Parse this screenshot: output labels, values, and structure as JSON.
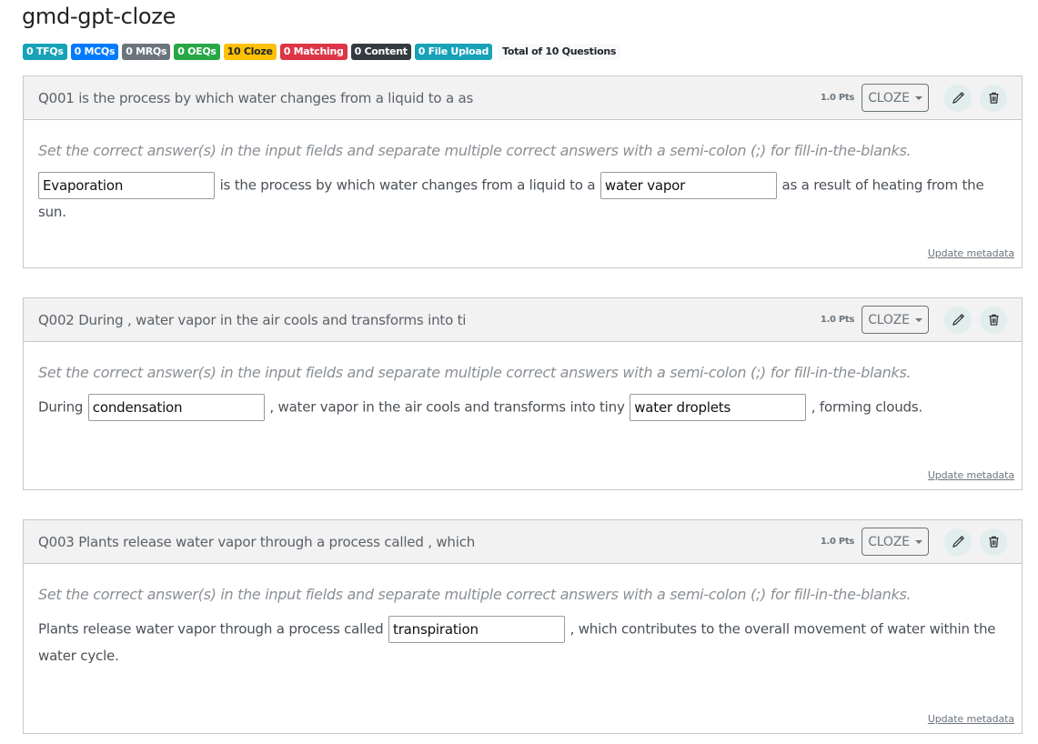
{
  "page": {
    "title": "gmd-gpt-cloze"
  },
  "badges": [
    {
      "label": "0 TFQs",
      "color": "#17a2b8"
    },
    {
      "label": "0 MCQs",
      "color": "#007bff"
    },
    {
      "label": "0 MRQs",
      "color": "#6c757d"
    },
    {
      "label": "0 OEQs",
      "color": "#28a745"
    },
    {
      "label": "10 Cloze",
      "color": "#ffc107"
    },
    {
      "label": "0 Matching",
      "color": "#dc3545"
    },
    {
      "label": "0 Content",
      "color": "#343a40"
    },
    {
      "label": "0 File Upload",
      "color": "#17a2b8"
    }
  ],
  "total_label": "Total of 10 Questions",
  "common": {
    "points": "1.0 Pts",
    "type": "CLOZE",
    "instructions": "Set the correct answer(s) in the input fields and separate multiple correct answers with a semi-colon (;) for fill-in-the-blanks.",
    "update_link": "Update metadata",
    "edit_icon": "pencil-icon",
    "delete_icon": "trash-icon"
  },
  "questions": [
    {
      "title": "Q001 is the process by which water changes from a liquid to a as",
      "parts": [
        {
          "blank": "Evaporation"
        },
        {
          "text": " is the process by which water changes from a liquid to a "
        },
        {
          "blank": "water vapor"
        },
        {
          "text": " as a result of heating from the sun."
        }
      ]
    },
    {
      "title": "Q002 During , water vapor in the air cools and transforms into ti",
      "parts": [
        {
          "text": "During "
        },
        {
          "blank": "condensation"
        },
        {
          "text": " , water vapor in the air cools and transforms into tiny "
        },
        {
          "blank": "water droplets"
        },
        {
          "text": " , forming clouds."
        }
      ]
    },
    {
      "title": "Q003 Plants release water vapor through a process called , which",
      "parts": [
        {
          "text": "Plants release water vapor through a process called "
        },
        {
          "blank": "transpiration"
        },
        {
          "text": " , which contributes to the overall movement of water within the water cycle."
        }
      ]
    }
  ]
}
